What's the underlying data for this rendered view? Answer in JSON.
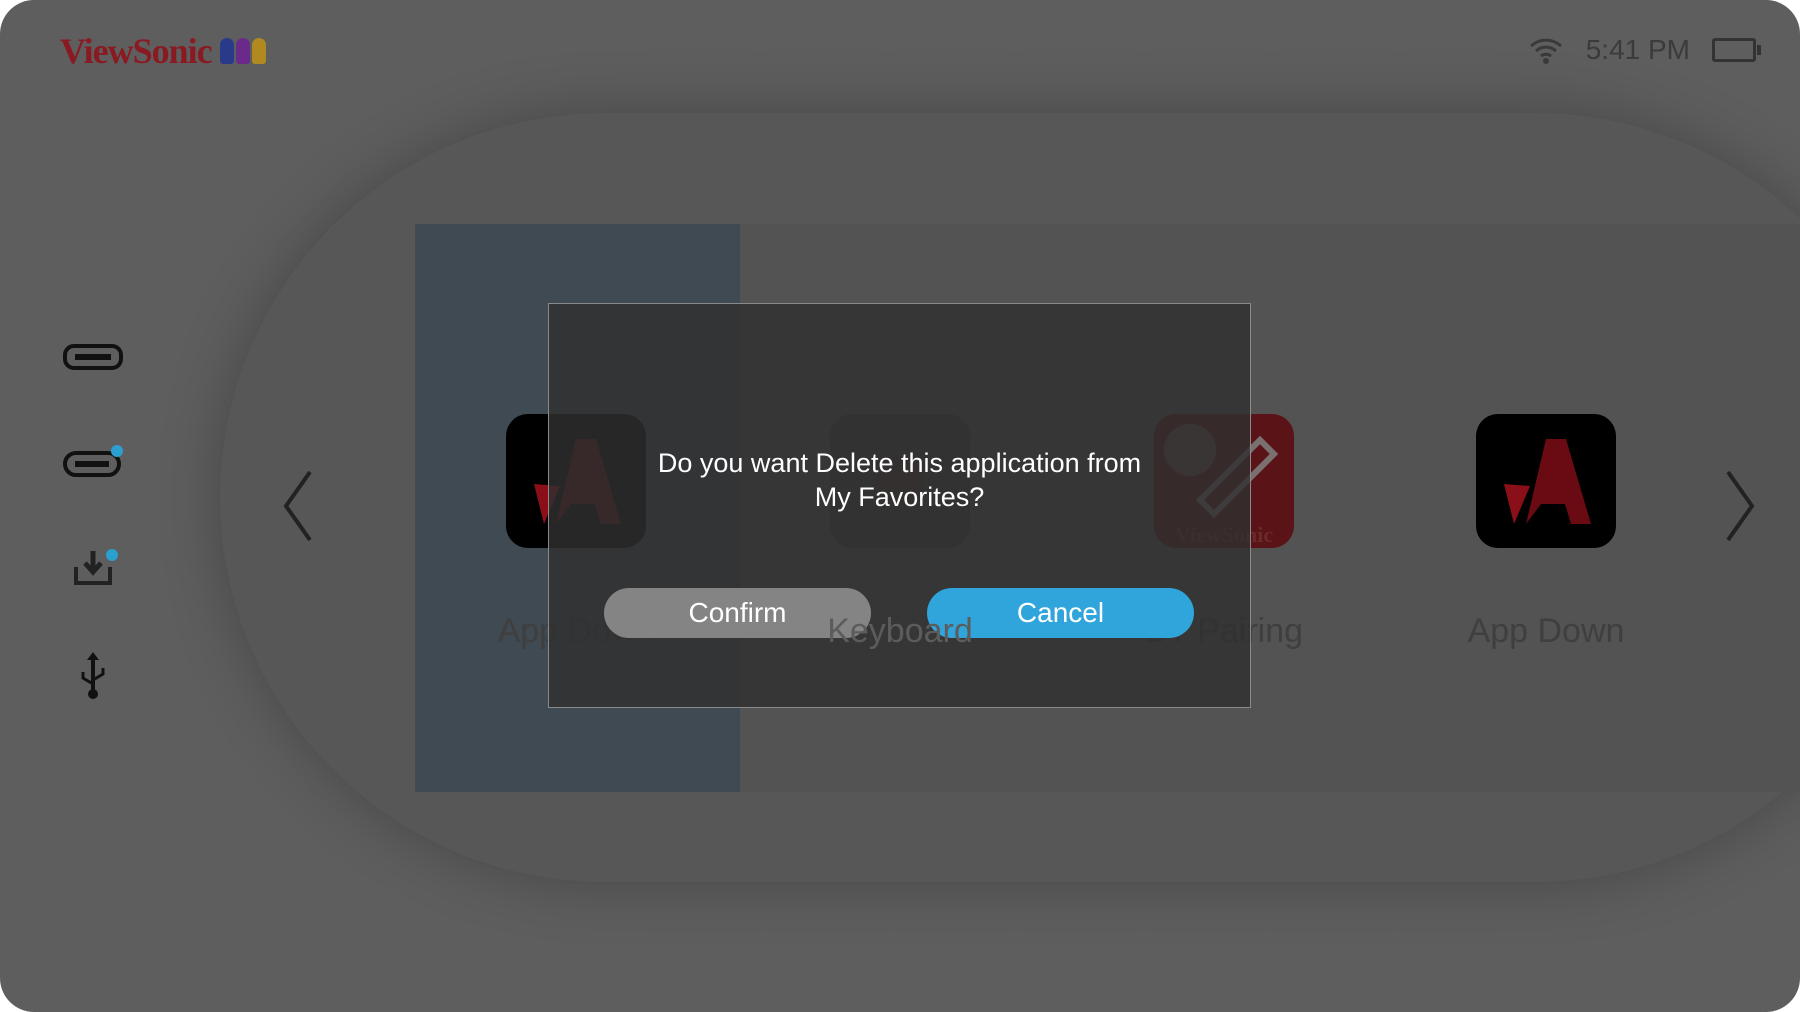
{
  "header": {
    "brand": "ViewSonic",
    "time": "5:41 PM",
    "wifi_icon": "wifi-icon",
    "battery_icon": "battery-charging-icon"
  },
  "sidebar": {
    "items": [
      {
        "icon": "hdmi-icon"
      },
      {
        "icon": "usb-c-icon",
        "badge": true
      },
      {
        "icon": "download-icon",
        "badge": true
      },
      {
        "icon": "usb-icon"
      }
    ]
  },
  "favorites": {
    "apps": [
      {
        "label": "App Down"
      },
      {
        "label": "Keyboard"
      },
      {
        "label": "BT Pairing",
        "brand": "ViewSonic"
      },
      {
        "label": "App Down"
      }
    ]
  },
  "dialog": {
    "message_line1": "Do you want Delete this application from",
    "message_line2": "My Favorites?",
    "confirm_label": "Confirm",
    "cancel_label": "Cancel"
  },
  "colors": {
    "accent": "#30a5dc",
    "brand": "#8a1a22"
  }
}
